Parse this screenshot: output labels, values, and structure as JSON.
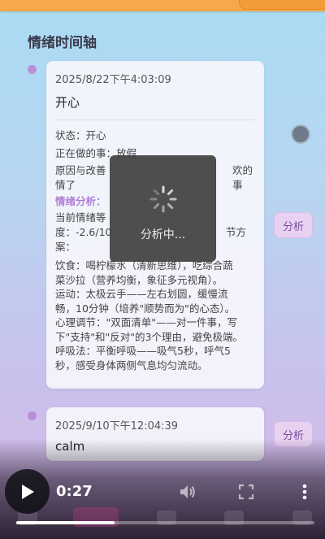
{
  "page": {
    "title": "情绪时间轴"
  },
  "entries": [
    {
      "date": "2025/8/22下午4:03:09",
      "emotion": "开心",
      "status": "状态：开心",
      "doing": "正在做的事：放假",
      "reason_a": "原因与改善",
      "reason_b": "欢的事",
      "reason_c": "情了",
      "analysis_label": "情绪分析：",
      "analysis_a": "当前情绪等",
      "analysis_b": "度：-2.6/10",
      "analysis_b2": "节方",
      "analysis_c": "案：",
      "tips": [
        "饮食：喝柠檬水（清新思维），吃综合蔬",
        "菜沙拉（营养均衡，象征多元视角）。",
        "运动：太极云手——左右划圆，缓慢流",
        "畅，10分钟（培养\"顺势而为\"的心态）。",
        "心理调节：\"双面清单\"——对一件事，写",
        "下\"支持\"和\"反对\"的3个理由，避免极端。",
        "呼吸法：平衡呼吸——吸气5秒，呼气5",
        "秒，感受身体两侧气息均匀流动。"
      ],
      "button": "分析"
    },
    {
      "date": "2025/9/10下午12:04:39",
      "emotion": "calm",
      "button": "分析"
    }
  ],
  "loading": {
    "text": "分析中..."
  },
  "video": {
    "time": "0:27",
    "progress": 0.33,
    "icons": [
      "play-icon",
      "volume-icon",
      "fullscreen-icon",
      "more-vert-icon"
    ]
  },
  "colors": {
    "accent": "#b07cd6",
    "topbar": "#f6a84a",
    "button_bg": "#e8d2f2"
  }
}
